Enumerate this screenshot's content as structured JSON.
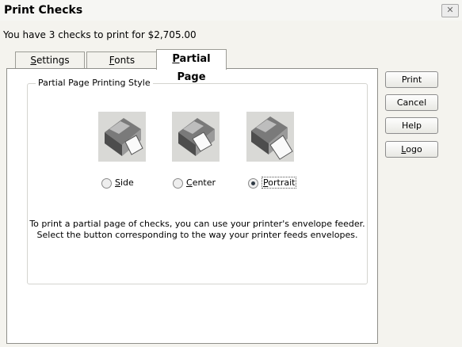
{
  "window": {
    "title": "Print Checks",
    "close_glyph": "✕"
  },
  "summary": "You have 3 checks to print for $2,705.00",
  "tabs": [
    {
      "key": "S",
      "rest": "ettings"
    },
    {
      "key": "F",
      "rest": "onts"
    },
    {
      "key": "P",
      "rest": "artial Page"
    }
  ],
  "active_tab": "Partial Page",
  "group": {
    "label": "Partial Page Printing Style",
    "options": [
      {
        "key": "S",
        "rest": "ide",
        "checked": false
      },
      {
        "key": "C",
        "rest": "enter",
        "checked": false
      },
      {
        "key": "P",
        "rest": "ortrait",
        "checked": true
      }
    ],
    "instructions": [
      "To print a partial page of checks,  you can use your printer's envelope feeder.",
      "Select the button corresponding to the way your printer feeds envelopes."
    ]
  },
  "buttons": {
    "print": "Print",
    "cancel": "Cancel",
    "help": "Help",
    "logo_key": "L",
    "logo_rest": "ogo"
  },
  "icons": [
    "printer-side-icon",
    "printer-center-icon",
    "printer-portrait-icon"
  ]
}
